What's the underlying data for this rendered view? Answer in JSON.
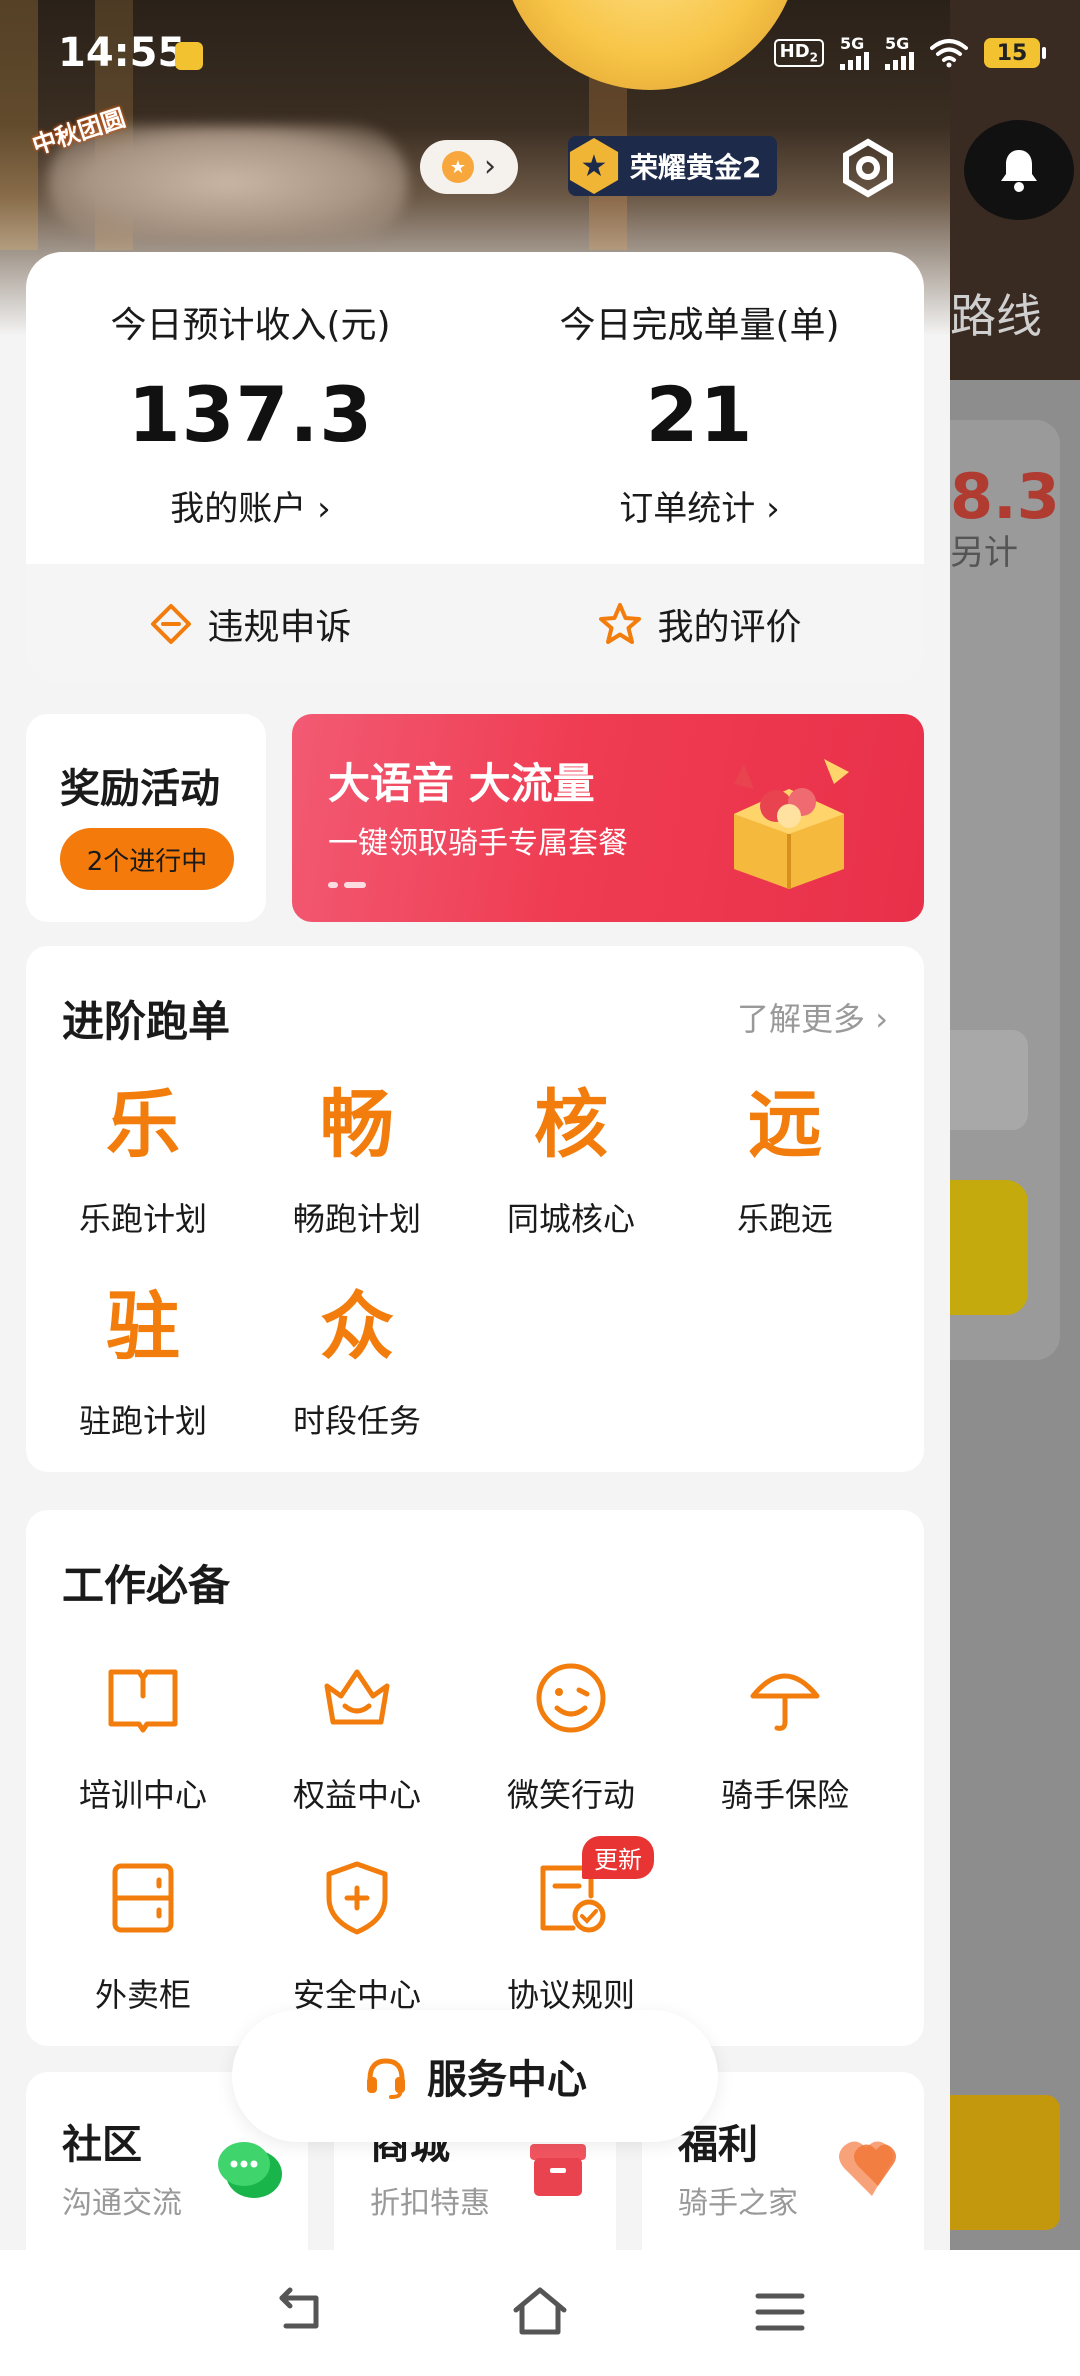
{
  "status_bar": {
    "time": "14:55",
    "hd_label": "HD",
    "hd_sub": "2",
    "signal1": "5G",
    "signal2": "5G",
    "battery": "15"
  },
  "header": {
    "logo_text": "中秋团圆",
    "rank_label": "荣耀黄金2"
  },
  "income": {
    "left_label": "今日预计收入(元)",
    "left_value": "137.3",
    "left_link": "我的账户 ›",
    "right_label": "今日完成单量(单)",
    "right_value": "21",
    "right_link": "订单统计 ›",
    "appeal_label": "违规申诉",
    "rating_label": "我的评价"
  },
  "reward": {
    "title": "奖励活动",
    "badge": "2个进行中"
  },
  "banner": {
    "title": "大语音 大流量",
    "subtitle": "一键领取骑手专属套餐"
  },
  "advanced": {
    "title": "进阶跑单",
    "more": "了解更多 ›",
    "items": [
      {
        "glyph": "乐",
        "label": "乐跑计划"
      },
      {
        "glyph": "畅",
        "label": "畅跑计划"
      },
      {
        "glyph": "核",
        "label": "同城核心"
      },
      {
        "glyph": "远",
        "label": "乐跑远"
      },
      {
        "glyph": "驻",
        "label": "驻跑计划"
      },
      {
        "glyph": "众",
        "label": "时段任务"
      }
    ]
  },
  "essentials": {
    "title": "工作必备",
    "items": [
      {
        "icon": "book-icon",
        "label": "培训中心"
      },
      {
        "icon": "crown-icon",
        "label": "权益中心"
      },
      {
        "icon": "smile-icon",
        "label": "微笑行动"
      },
      {
        "icon": "umbrella-icon",
        "label": "骑手保险"
      },
      {
        "icon": "locker-icon",
        "label": "外卖柜"
      },
      {
        "icon": "shield-plus-icon",
        "label": "安全中心"
      },
      {
        "icon": "document-check-icon",
        "label": "协议规则",
        "tag": "更新"
      }
    ]
  },
  "service_center": {
    "label": "服务中心"
  },
  "tiles": [
    {
      "title": "社区",
      "subtitle": "沟通交流",
      "icon": "chat-icon"
    },
    {
      "title": "商城",
      "subtitle": "折扣特惠",
      "icon": "box-icon"
    },
    {
      "title": "福利",
      "subtitle": "骑手之家",
      "icon": "heart-icon"
    }
  ],
  "background_app": {
    "route_text": "路线",
    "amount_text": "8.3",
    "sub_text": "另计"
  },
  "colors": {
    "accent": "#f27d0c",
    "rank_bg": "#1e2a4a",
    "banner": "#ef3c52",
    "tag_red": "#e93434"
  }
}
